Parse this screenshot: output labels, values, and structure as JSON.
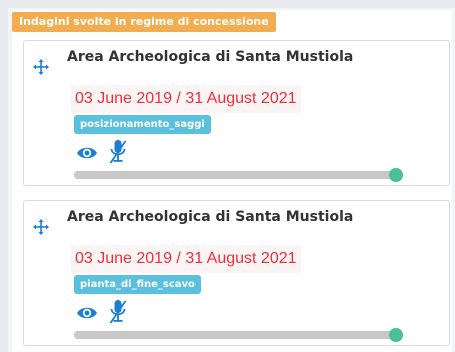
{
  "section": {
    "title": "Indagini svolte in regime di concessione"
  },
  "colors": {
    "badge": "#f1ad4e",
    "date": "#ec2f3c",
    "tag": "#5bc0de",
    "icon": "#1a7fd4",
    "slider_thumb": "#48c193"
  },
  "cards": [
    {
      "title": "Area Archeologica di Santa Mustiola",
      "date_range": "03 June 2019 / 31 August 2021",
      "layer": "posizionamento_saggi",
      "opacity": 1.0,
      "icons": [
        "move-icon",
        "eye-icon",
        "microphone-icon"
      ]
    },
    {
      "title": "Area Archeologica di Santa Mustiola",
      "date_range": "03 June 2019 / 31 August 2021",
      "layer": "pianta_di_fine_scavo",
      "opacity": 1.0,
      "icons": [
        "move-icon",
        "eye-icon",
        "microphone-icon"
      ]
    }
  ]
}
